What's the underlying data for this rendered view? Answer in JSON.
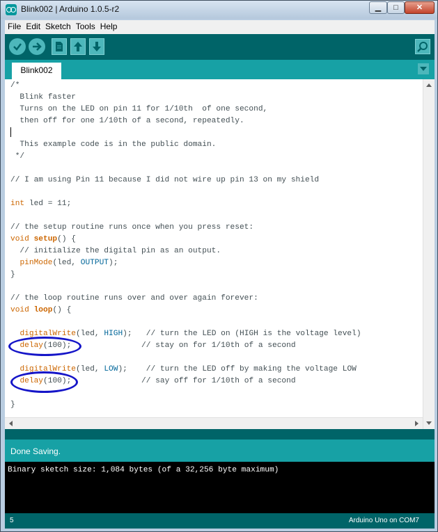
{
  "window": {
    "title": "Blink002 | Arduino 1.0.5-r2"
  },
  "menu": [
    "File",
    "Edit",
    "Sketch",
    "Tools",
    "Help"
  ],
  "toolbar": {
    "verify_icon": "check-icon",
    "upload_icon": "arrow-right-icon",
    "new_icon": "document-icon",
    "open_icon": "arrow-up-icon",
    "save_icon": "arrow-down-icon",
    "serial_icon": "magnifier-icon"
  },
  "tab": {
    "label": "Blink002"
  },
  "code": {
    "l1": "/*",
    "l2": "  Blink faster",
    "l3": "  Turns on the LED on pin 11 for 1/10th  of one second,",
    "l4": "  then off for one 1/10th of a second, repeatedly.",
    "l6": "  This example code is in the public domain.",
    "l7": " */",
    "l9": "// I am using Pin 11 because I did not wire up pin 13 on my shield",
    "l11_kw": "int",
    "l11_rest": " led = 11;",
    "l13": "// the setup routine runs once when you press reset:",
    "l14_kw": "void",
    "l14_fn": "setup",
    "l14_rest": "() {",
    "l15": "  // initialize the digital pin as an output.",
    "l16_fn": "pinMode",
    "l16_a": "(led, ",
    "l16_cn": "OUTPUT",
    "l16_b": ");",
    "l17": "}",
    "l19": "// the loop routine runs over and over again forever:",
    "l20_kw": "void",
    "l20_fn": "loop",
    "l20_rest": "() {",
    "l22_fn": "digitalWrite",
    "l22_a": "(led, ",
    "l22_cn": "HIGH",
    "l22_b": ");   ",
    "l22_cm": "// turn the LED on (HIGH is the voltage level)",
    "l23_fn": "delay",
    "l23_a": "(100);               ",
    "l23_cm": "// stay on for 1/10th of a second",
    "l25_fn": "digitalWrite",
    "l25_a": "(led, ",
    "l25_cn": "LOW",
    "l25_b": ");    ",
    "l25_cm": "// turn the LED off by making the voltage LOW",
    "l26_fn": "delay",
    "l26_a": "(100);               ",
    "l26_cm": "// say off for 1/10th of a second",
    "l28": "}"
  },
  "status": {
    "message": "Done Saving."
  },
  "console": {
    "output": "Binary sketch size: 1,084 bytes (of a 32,256 byte maximum)"
  },
  "footer": {
    "line_number": "5",
    "board": "Arduino Uno on COM7"
  },
  "colors": {
    "teal_dark": "#006468",
    "teal_light": "#17a1a5",
    "annotation_circle": "#1515c8"
  }
}
